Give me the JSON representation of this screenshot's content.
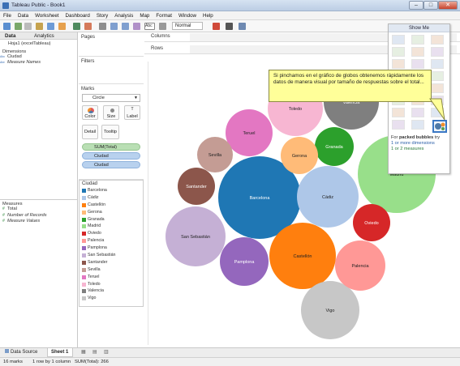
{
  "window": {
    "title": "Tableau Public - Book1",
    "minimize": "–",
    "maximize": "□",
    "close": "✕"
  },
  "menu": [
    "File",
    "Data",
    "Worksheet",
    "Dashboard",
    "Story",
    "Analysis",
    "Map",
    "Format",
    "Window",
    "Help"
  ],
  "toolbar": {
    "mark_select": "Normal",
    "abc_label": "Abc"
  },
  "data_pane": {
    "tab_data": "Data",
    "tab_analytics": "Analytics",
    "source": "Hoja1 (excelTableau)",
    "dimensions_title": "Dimensions",
    "dimensions": [
      "Ciudad",
      "Measure Names"
    ],
    "measures_title": "Measures",
    "measures": [
      "Total",
      "Number of Records",
      "Measure Values"
    ]
  },
  "pages_title": "Pages",
  "filters_title": "Filters",
  "marks": {
    "title": "Marks",
    "type": "Circle",
    "buttons": [
      "Color",
      "Size",
      "Label",
      "Detail",
      "Tooltip"
    ],
    "pills": [
      "SUM(Total)",
      "Ciudad",
      "Ciudad"
    ]
  },
  "legend": {
    "title": "Ciudad",
    "items": [
      {
        "name": "Barcelona",
        "color": "#1f77b4"
      },
      {
        "name": "Cádiz",
        "color": "#aec7e8"
      },
      {
        "name": "Castellón",
        "color": "#ff7f0e"
      },
      {
        "name": "Gerona",
        "color": "#ffbb78"
      },
      {
        "name": "Granada",
        "color": "#2ca02c"
      },
      {
        "name": "Madrid",
        "color": "#98df8a"
      },
      {
        "name": "Oviedo",
        "color": "#d62728"
      },
      {
        "name": "Palencia",
        "color": "#ff9896"
      },
      {
        "name": "Pamplona",
        "color": "#9467bd"
      },
      {
        "name": "San Sebastián",
        "color": "#c5b0d5"
      },
      {
        "name": "Santander",
        "color": "#8c564b"
      },
      {
        "name": "Sevilla",
        "color": "#c49c94"
      },
      {
        "name": "Teruel",
        "color": "#e377c2"
      },
      {
        "name": "Toledo",
        "color": "#f7b6d2"
      },
      {
        "name": "Valencia",
        "color": "#7f7f7f"
      },
      {
        "name": "Vigo",
        "color": "#c7c7c7"
      }
    ]
  },
  "shelves": {
    "columns": "Columns",
    "rows": "Rows"
  },
  "chart_data": {
    "type": "packed-bubbles",
    "measure": "SUM(Total)",
    "bubbles": [
      {
        "label": "Barcelona",
        "color": "#1f77b4",
        "value": 32
      },
      {
        "label": "Madrid",
        "color": "#98df8a",
        "value": 24
      },
      {
        "label": "Castellón",
        "color": "#ff7f0e",
        "value": 24
      },
      {
        "label": "San Sebastián",
        "color": "#c5b0d5",
        "value": 15
      },
      {
        "label": "Cádiz",
        "color": "#aec7e8",
        "value": 15
      },
      {
        "label": "Vigo",
        "color": "#c7c7c7",
        "value": 13
      },
      {
        "label": "Toledo",
        "color": "#f7b6d2",
        "value": 12
      },
      {
        "label": "Palencia",
        "color": "#ff9896",
        "value": 10
      },
      {
        "label": "Pamplona",
        "color": "#9467bd",
        "value": 10
      },
      {
        "label": "Valencia",
        "color": "#7f7f7f",
        "value": 10
      },
      {
        "label": "Teruel",
        "color": "#e377c2",
        "value": 9
      },
      {
        "label": "Santander",
        "color": "#8c564b",
        "value": 6
      },
      {
        "label": "Granada",
        "color": "#2ca02c",
        "value": 6
      },
      {
        "label": "Gerona",
        "color": "#ffbb78",
        "value": 6
      },
      {
        "label": "Oviedo",
        "color": "#d62728",
        "value": 6
      },
      {
        "label": "Sevilla",
        "color": "#c49c94",
        "value": 5
      }
    ]
  },
  "show_me": {
    "title": "Show Me",
    "hint_prefix": "For",
    "hint_chart": "packed bubbles",
    "hint_suffix": "try",
    "hint_dims": "1 or more dimensions",
    "hint_measures": "1 or 2 measures"
  },
  "callout": "Si pinchamos en el gráfico de globos obtenemos rápidamente los datos de manera visual por tamaño de respuestas sobre el total...",
  "tabs": {
    "data_source": "Data Source",
    "sheet1": "Sheet 1"
  },
  "status": {
    "marks": "16 marks",
    "dims": "1 row by 1 column",
    "sum": "SUM(Total): 266"
  }
}
